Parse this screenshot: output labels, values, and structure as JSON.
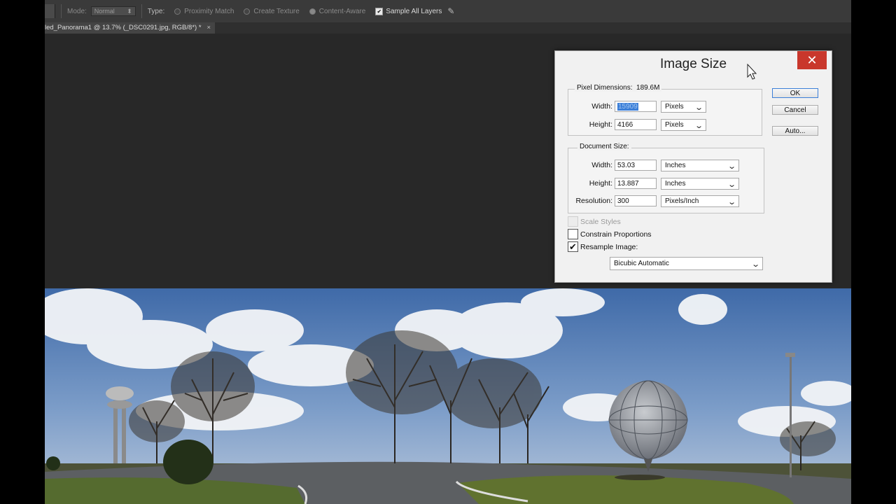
{
  "options_bar": {
    "mode_label": "Mode:",
    "mode_value": "Normal",
    "type_label": "Type:",
    "radio_proximity": "Proximity Match",
    "radio_create_texture": "Create Texture",
    "radio_content_aware": "Content-Aware",
    "sample_all_layers": "Sample All Layers"
  },
  "document_tab": {
    "title": "led_Panorama1 @ 13.7% (_DSC0291.jpg, RGB/8*) *",
    "close": "×"
  },
  "dialog": {
    "title": "Image Size",
    "close": "✕",
    "pixel_dimensions": {
      "label": "Pixel Dimensions:",
      "value": "189.6M",
      "width_label": "Width:",
      "width_value": "15909",
      "width_unit": "Pixels",
      "height_label": "Height:",
      "height_value": "4166",
      "height_unit": "Pixels"
    },
    "document_size": {
      "label": "Document Size:",
      "width_label": "Width:",
      "width_value": "53.03",
      "width_unit": "Inches",
      "height_label": "Height:",
      "height_value": "13.887",
      "height_unit": "Inches",
      "resolution_label": "Resolution:",
      "resolution_value": "300",
      "resolution_unit": "Pixels/Inch"
    },
    "scale_styles": "Scale Styles",
    "constrain_proportions": "Constrain Proportions",
    "resample_image": "Resample Image:",
    "resample_method": "Bicubic Automatic",
    "ok": "OK",
    "cancel": "Cancel",
    "auto": "Auto..."
  },
  "colors": {
    "close_red": "#c9372c",
    "selection_blue": "#3c7fd8",
    "panel_dark": "#282828"
  }
}
